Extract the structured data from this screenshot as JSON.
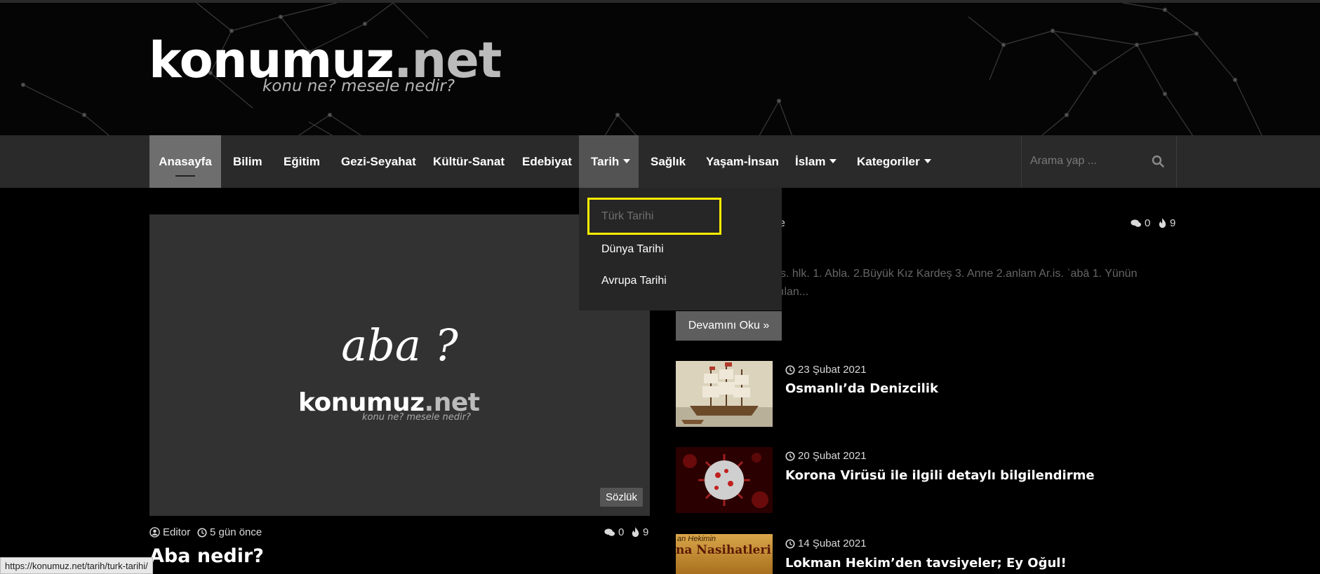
{
  "site": {
    "logo_main": "konumuz",
    "logo_dot": ".net",
    "logo_tagline": "konu ne? mesele nedir?"
  },
  "nav": {
    "items": [
      {
        "label": "Anasayfa"
      },
      {
        "label": "Bilim"
      },
      {
        "label": "Eğitim"
      },
      {
        "label": "Gezi-Seyahat"
      },
      {
        "label": "Kültür-Sanat"
      },
      {
        "label": "Edebiyat"
      },
      {
        "label": "Tarih"
      },
      {
        "label": "Sağlık"
      },
      {
        "label": "Yaşam-İnsan"
      },
      {
        "label": "İslam"
      },
      {
        "label": "Kategoriler"
      }
    ],
    "search_placeholder": "Arama yap ..."
  },
  "dropdown": {
    "items": [
      "Türk Tarihi",
      "Dünya Tarihi",
      "Avrupa Tarihi"
    ]
  },
  "featured": {
    "image_text": "aba ?",
    "image_logo_main": "konumuz",
    "image_logo_dot": ".net",
    "image_logo_tagline": "konu ne? mesele nedir?",
    "category_badge": "Sözlük",
    "author": "Editor",
    "time": "5 gün önce",
    "comments": "0",
    "views": "9",
    "title": "Aba nedir?"
  },
  "right": {
    "partial_meta_text": "e",
    "comments": "0",
    "views": "9",
    "excerpt_line1": "s. hlk. 1. Abla. 2.Büyük Kız Kardeş 3. Anne 2.anlam Ar.is. ʿabā 1. Yünün",
    "excerpt_line2": "ılan...",
    "read_more": "Devamını Oku »",
    "posts": [
      {
        "date": "23 Şubat 2021",
        "title": "Osmanlı’da Denizcilik"
      },
      {
        "date": "20 Şubat 2021",
        "title": "Korona Virüsü ile ilgili detaylı bilgilendirme"
      },
      {
        "date": "14 Şubat 2021",
        "title": "Lokman Hekim’den tavsiyeler; Ey Oğul!",
        "thumb_text1": "an Hekimin",
        "thumb_text2": "na Nasihatleri"
      }
    ]
  },
  "status_bar": {
    "url": "https://konumuz.net/tarih/turk-tarihi/"
  }
}
